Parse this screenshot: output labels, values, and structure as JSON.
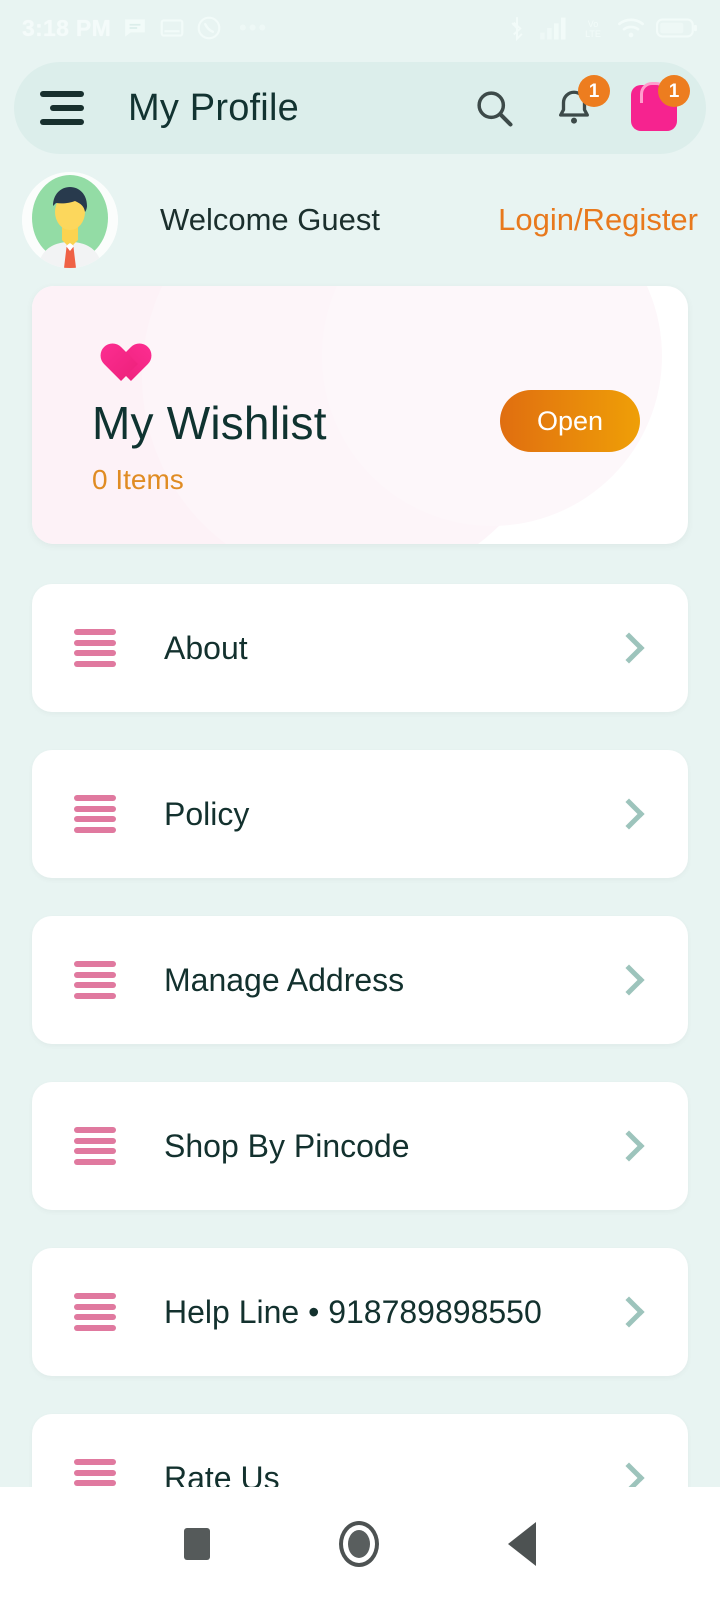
{
  "status_bar": {
    "time": "3:18 PM",
    "left_icons": [
      "message-icon",
      "mail-icon",
      "missed-call-icon",
      "more-dots-icon"
    ],
    "right_icons": [
      "bluetooth-icon",
      "signal-icon",
      "volte-icon",
      "wifi-icon",
      "battery-icon"
    ],
    "battery_level": "64"
  },
  "appbar": {
    "menu_icon": "hamburger-menu-icon",
    "title": "My Profile",
    "search_icon": "search-icon",
    "notification_icon": "bell-icon",
    "notification_badge": "1",
    "cart_icon": "shopping-bag-icon",
    "cart_badge": "1"
  },
  "welcome": {
    "avatar": "user-avatar",
    "greeting": "Welcome Guest",
    "login_label": "Login/Register"
  },
  "wishlist": {
    "icon": "heart-icon",
    "title": "My Wishlist",
    "subtitle": "0 Items",
    "open_label": "Open"
  },
  "menu": {
    "items": [
      {
        "label": "About",
        "icon": "list-lines-icon",
        "chevron": "chevron-right-icon"
      },
      {
        "label": "Policy",
        "icon": "list-lines-icon",
        "chevron": "chevron-right-icon"
      },
      {
        "label": "Manage Address",
        "icon": "list-lines-icon",
        "chevron": "chevron-right-icon"
      },
      {
        "label": "Shop By Pincode",
        "icon": "list-lines-icon",
        "chevron": "chevron-right-icon"
      },
      {
        "label": "Help Line • 918789898550",
        "icon": "list-lines-icon",
        "chevron": "chevron-right-icon"
      },
      {
        "label": "Rate Us",
        "icon": "list-lines-icon",
        "chevron": "chevron-right-icon"
      }
    ]
  },
  "navbar": {
    "recents_label": "Recents",
    "home_label": "Home",
    "back_label": "Back"
  },
  "colors": {
    "background": "#e8f4f2",
    "appbar": "#dceeeb",
    "accent_orange": "#e8791d",
    "accent_pink": "#f6238f",
    "icon_pink": "#e0799f",
    "text_dark": "#13312e",
    "chevron": "#9dc4bc"
  }
}
